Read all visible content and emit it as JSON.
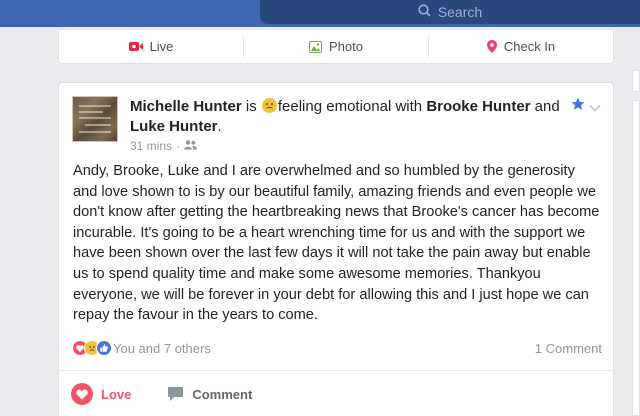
{
  "search": {
    "placeholder": "Search"
  },
  "composer": {
    "live": "Live",
    "photo": "Photo",
    "checkin": "Check In"
  },
  "post": {
    "author": "Michelle Hunter",
    "is": "is",
    "feeling": "feeling emotional with",
    "tag1": "Brooke Hunter",
    "and": "and",
    "tag2": "Luke Hunter",
    "period": ".",
    "time": "31 mins",
    "dot": "·",
    "text": "Andy, Brooke, Luke and I are overwhelmed and so humbled by the generosity and love shown to is by our beautiful family, amazing friends and even people we don't know after getting the heartbreaking news that Brooke's cancer has become incurable. It's going to be a heart wrenching time for us and with the support we have been shown over the last few days it will not take the pain away but enable us to spend quality time and make some awesome memories. Thankyou everyone, we will be forever in your debt for allowing this and I just hope we can repay the favour in the years to come.",
    "reactions_text": "You and 7 others",
    "comments_count": "1 Comment",
    "love_label": "Love",
    "comment_label": "Comment"
  },
  "icons": [
    "search-icon",
    "live-video-icon",
    "photo-icon",
    "location-pin-icon",
    "feeling-emoji-icon",
    "friends-audience-icon",
    "star-icon",
    "chevron-down-icon",
    "love-reaction-icon",
    "sad-reaction-icon",
    "like-reaction-icon",
    "heart-icon",
    "comment-icon"
  ],
  "colors": {
    "brand": "#4267b2",
    "love": "#f25268",
    "like": "#4a76d4",
    "star": "#4a76d4"
  }
}
